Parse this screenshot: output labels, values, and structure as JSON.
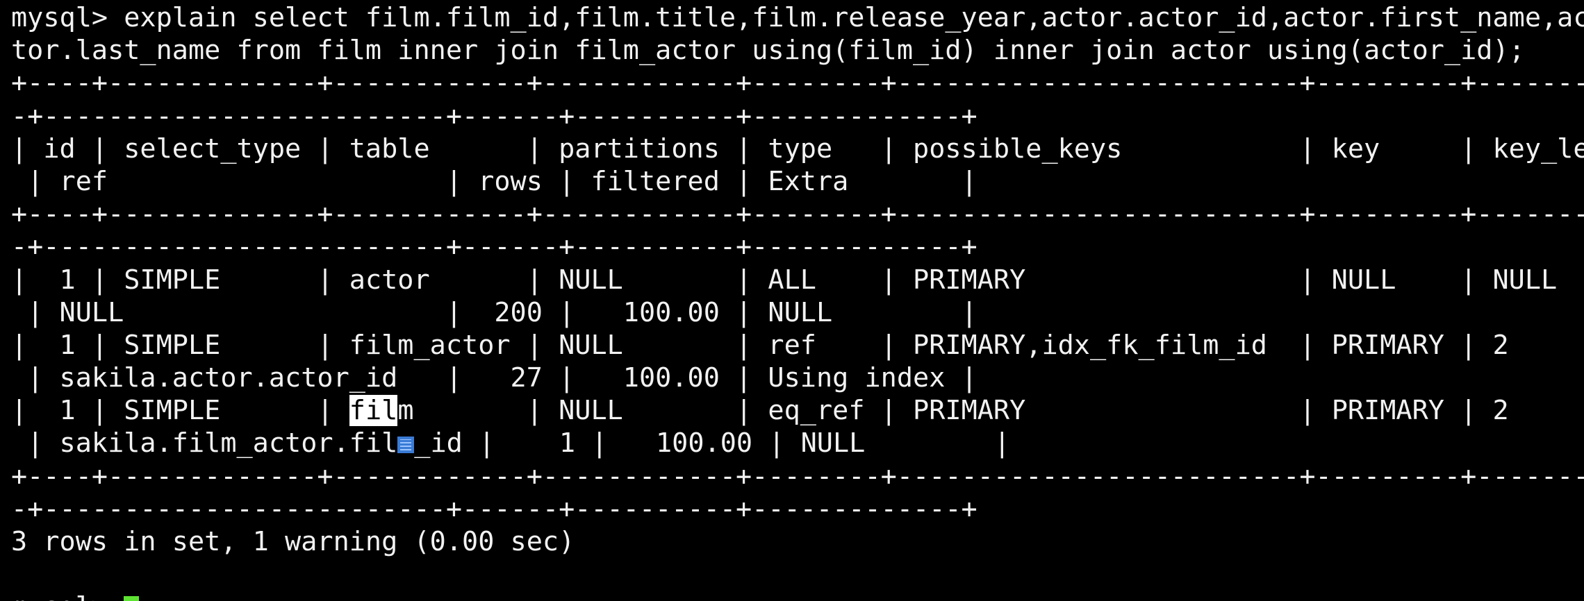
{
  "terminal": {
    "lines": [
      "mysql> explain select film.film_id,film.title,film.release_year,actor.actor_id,actor.first_name,ac",
      "tor.last_name from film inner join film_actor using(film_id) inner join actor using(actor_id);",
      "+----+-------------+------------+------------+--------+-------------------------+---------+--------",
      "-+-------------------------+------+----------+-------------+",
      "| id | select_type | table      | partitions | type   | possible_keys           | key     | key_len",
      " | ref                     | rows | filtered | Extra       |",
      "+----+-------------+------------+------------+--------+-------------------------+---------+--------",
      "-+-------------------------+------+----------+-------------+",
      "|  1 | SIMPLE      | actor      | NULL       | ALL    | PRIMARY                 | NULL    | NULL",
      " | NULL                    |  200 |   100.00 | NULL        |",
      "|  1 | SIMPLE      | film_actor | NULL       | ref    | PRIMARY,idx_fk_film_id  | PRIMARY | 2",
      " | sakila.actor.actor_id   |   27 |   100.00 | Using index |"
    ],
    "row3_line1": {
      "before": "|  1 | SIMPLE      | ",
      "selected": "fil",
      "after": "m       | NULL       | eq_ref | PRIMARY                 | PRIMARY | 2"
    },
    "row3_line2": {
      "before": " | sakila.film_actor.fil",
      "after": "_id |    1 |   100.00 | NULL        |"
    },
    "footer_lines": [
      "+----+-------------+------------+------------+--------+-------------------------+---------+--------",
      "-+-------------------------+------+----------+-------------+",
      "3 rows in set, 1 warning (0.00 sec)",
      ""
    ],
    "prompt_partial": "mysql> ",
    "cursor_color": "#5ee332"
  }
}
